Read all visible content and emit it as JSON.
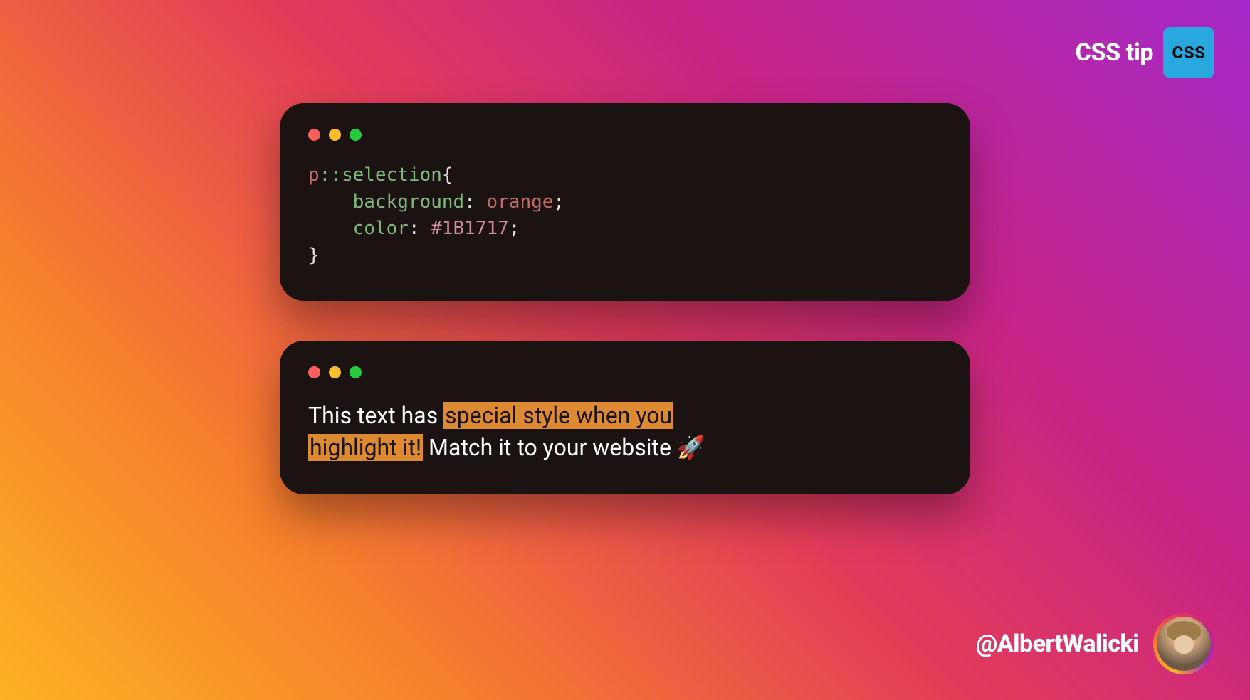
{
  "header": {
    "title": "CSS tip",
    "badge": "CSS"
  },
  "code": {
    "selector": "p",
    "pseudo": "::selection",
    "open": "{",
    "prop1": "background",
    "val1": "orange",
    "prop2": "color",
    "val2": "#1B1717",
    "close": "}",
    "colon": ":",
    "semi": ";"
  },
  "demo": {
    "before": "This text has ",
    "highlight1": "special style when you ",
    "highlight2": "highlight it!",
    "after": " Match it to your website ",
    "emoji": "🚀"
  },
  "footer": {
    "handle": "@AlbertWalicki"
  }
}
